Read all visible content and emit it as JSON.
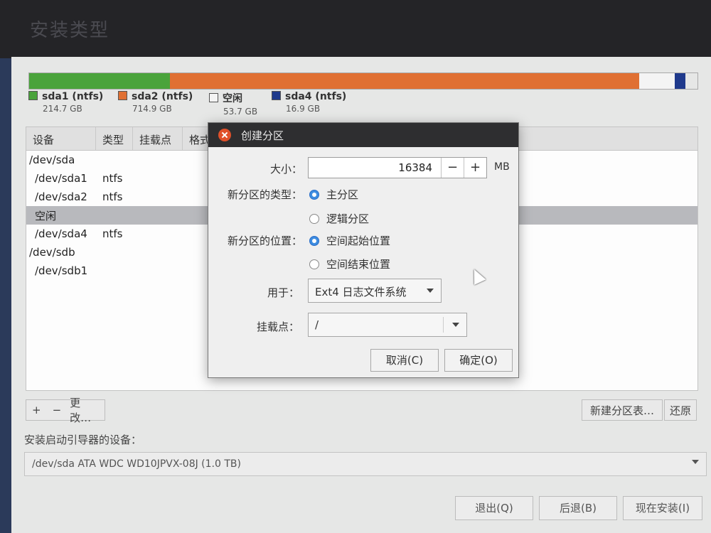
{
  "page_title": "安装类型",
  "partitions": [
    {
      "name": "sda1 (ntfs)",
      "size": "214.7 GB",
      "color": "#4aa33b",
      "share": 0.2107
    },
    {
      "name": "sda2 (ntfs)",
      "size": "714.9 GB",
      "color": "#e07033",
      "share": 0.7021
    },
    {
      "name": "空闲",
      "size": "53.7 GB",
      "color": "#f4f4f4",
      "share": 0.0527
    },
    {
      "name": "sda4 (ntfs)",
      "size": "16.9 GB",
      "color": "#1f3a8c",
      "share": 0.0166
    }
  ],
  "table": {
    "headers": [
      "设备",
      "类型",
      "挂载点",
      "格式"
    ],
    "rows": [
      {
        "device": "/dev/sda",
        "type": ""
      },
      {
        "device": "/dev/sda1",
        "type": "ntfs"
      },
      {
        "device": "/dev/sda2",
        "type": "ntfs"
      },
      {
        "device": "空闲",
        "type": ""
      },
      {
        "device": "/dev/sda4",
        "type": "ntfs"
      },
      {
        "device": "/dev/sdb",
        "type": ""
      },
      {
        "device": "/dev/sdb1",
        "type": ""
      }
    ]
  },
  "table_toolbar": {
    "add": "+",
    "remove": "−",
    "change": "更改…"
  },
  "new_table_button": "新建分区表…",
  "revert_button": "还原",
  "boot_loader": {
    "label": "安装启动引导器的设备：",
    "value": "/dev/sda   ATA WDC WD10JPVX-08J (1.0 TB)"
  },
  "footer": {
    "quit": "退出(Q)",
    "back": "后退(B)",
    "install": "现在安装(I)"
  },
  "dialog": {
    "title": "创建分区",
    "size_label": "大小：",
    "size_value": "16384",
    "minus": "−",
    "plus": "+",
    "unit": "MB",
    "type_label": "新分区的类型：",
    "type_primary": "主分区",
    "type_logical": "逻辑分区",
    "location_label": "新分区的位置：",
    "location_start": "空间起始位置",
    "location_end": "空间结束位置",
    "use_label": "用于：",
    "use_value": "Ext4 日志文件系统",
    "mount_label": "挂载点：",
    "mount_value": "/",
    "cancel": "取消(C)",
    "ok": "确定(O)"
  },
  "icons": {
    "close": "close-icon",
    "dropdown": "chevron-down-icon",
    "pointer": "mouse-pointer-icon"
  }
}
